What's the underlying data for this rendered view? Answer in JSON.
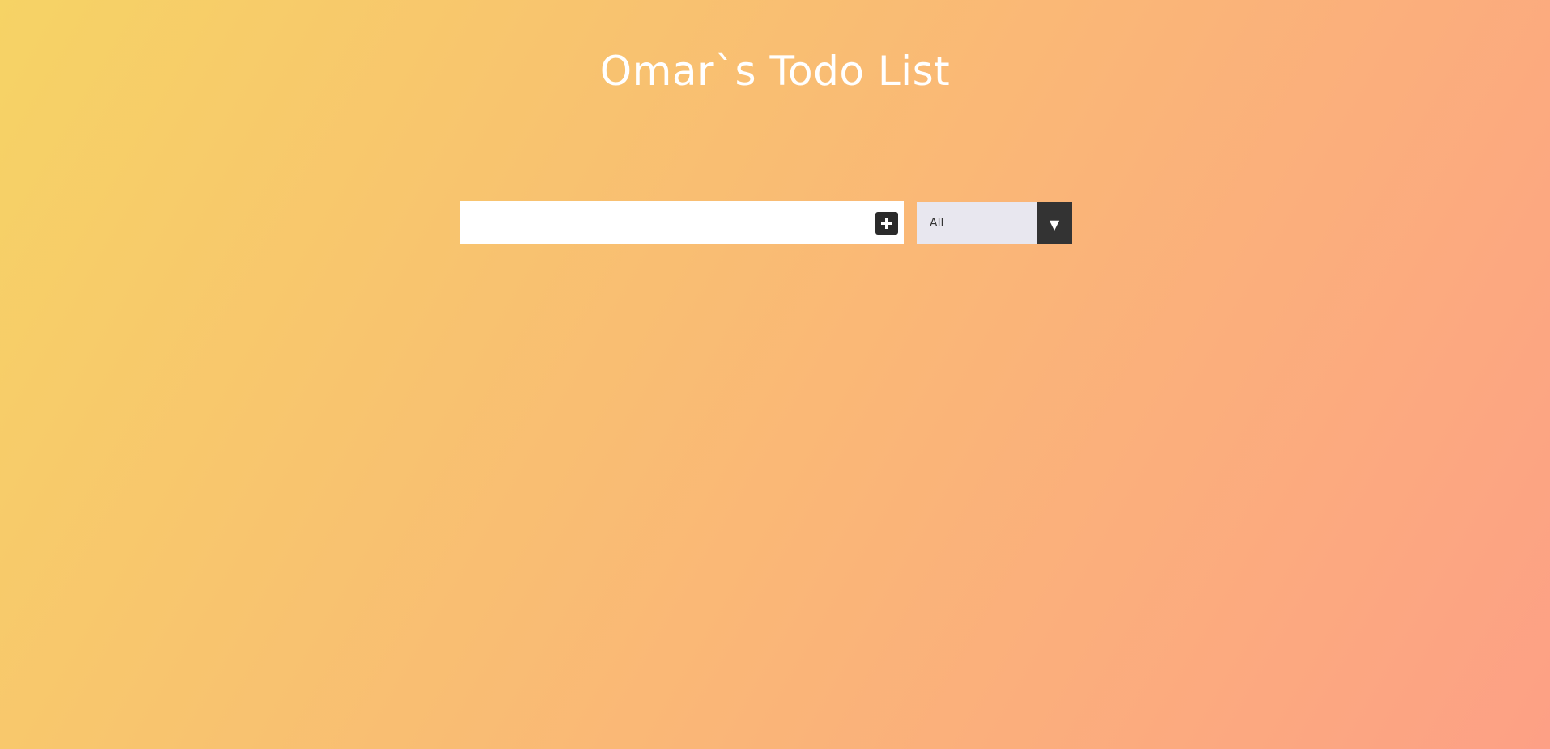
{
  "page": {
    "title": "Omar`s Todo List"
  },
  "form": {
    "input_value": "",
    "input_placeholder": "",
    "add_icon": "plus-square-icon"
  },
  "filter": {
    "selected": "All",
    "arrow_icon": "triangle-down-icon"
  },
  "colors": {
    "gradient_start": "#f6d365",
    "gradient_end": "#fda085",
    "button_dark": "#333333",
    "select_bg": "#e8e7ef"
  }
}
